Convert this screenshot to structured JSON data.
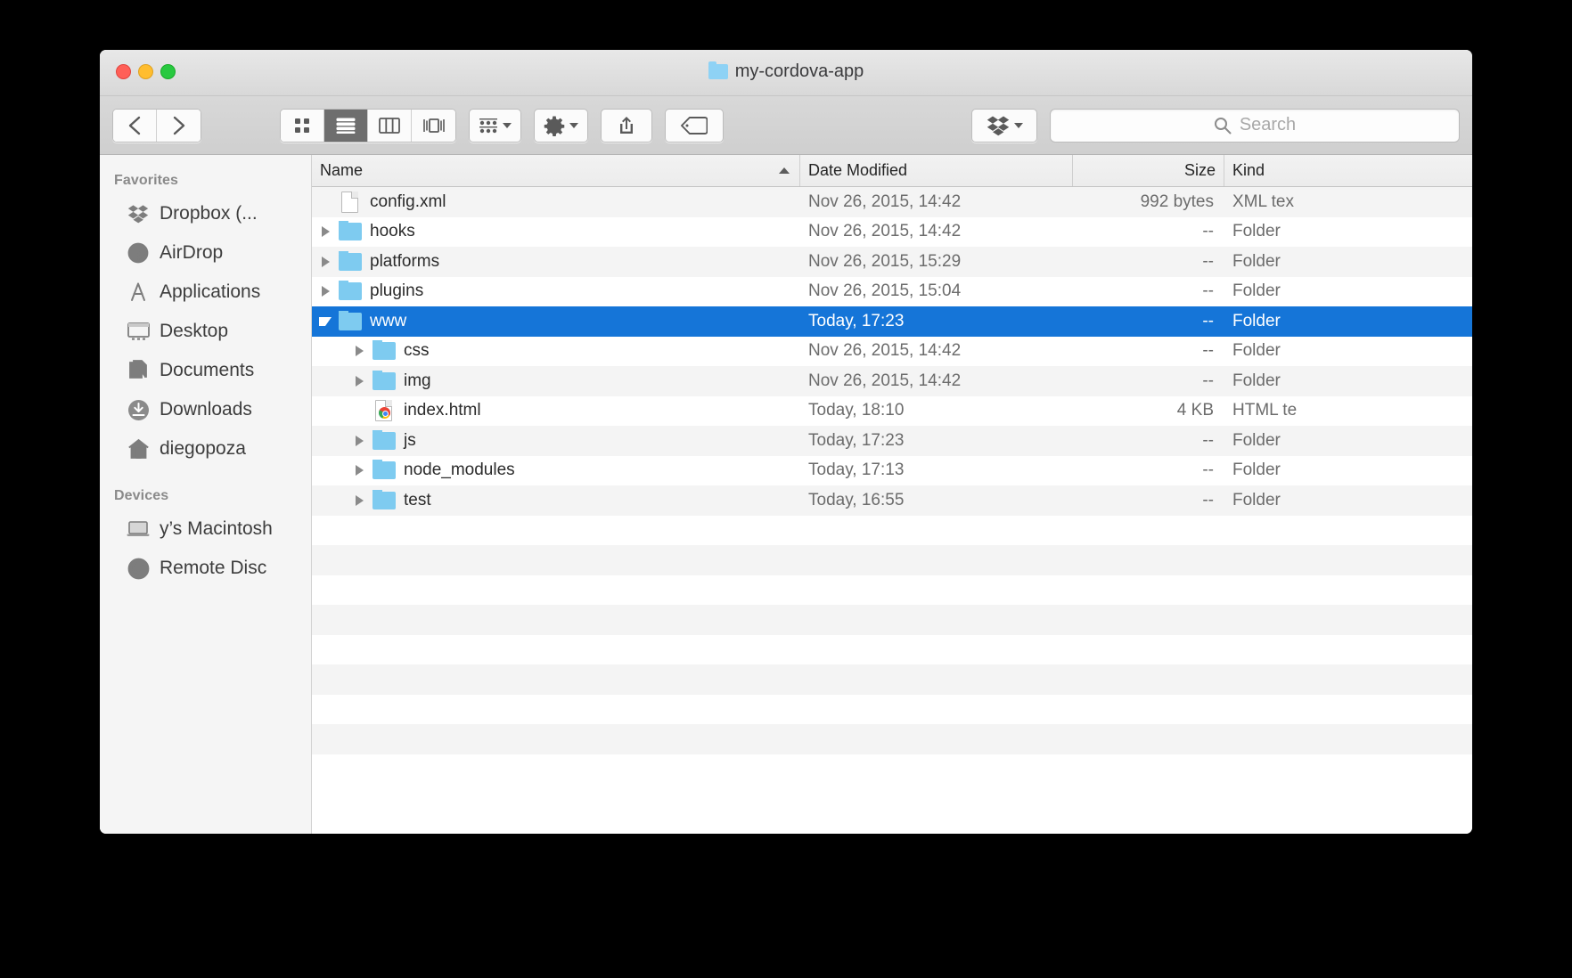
{
  "window": {
    "title": "my-cordova-app",
    "title_icon": "folder-icon",
    "controls": {
      "close": "close-button",
      "minimize": "minimize-button",
      "maximize": "maximize-button"
    }
  },
  "toolbar": {
    "back_label": "‹",
    "forward_label": "›",
    "view_modes": [
      {
        "name": "icon-view",
        "active": false
      },
      {
        "name": "list-view",
        "active": true
      },
      {
        "name": "column-view",
        "active": false
      },
      {
        "name": "coverflow-view",
        "active": false
      }
    ],
    "arrange_label": "arrange-icon",
    "action_label": "gear-icon",
    "share_label": "share-icon",
    "tag_label": "tag-icon",
    "dropbox_label": "dropbox-icon"
  },
  "search": {
    "placeholder": "Search",
    "value": ""
  },
  "sidebar": {
    "sections": [
      {
        "header": "Favorites",
        "items": [
          {
            "label": "Dropbox (...",
            "icon": "dropbox-icon"
          },
          {
            "label": "AirDrop",
            "icon": "airdrop-icon"
          },
          {
            "label": "Applications",
            "icon": "applications-icon"
          },
          {
            "label": "Desktop",
            "icon": "desktop-icon"
          },
          {
            "label": "Documents",
            "icon": "documents-icon"
          },
          {
            "label": "Downloads",
            "icon": "downloads-icon"
          },
          {
            "label": "diegopoza",
            "icon": "home-icon"
          }
        ]
      },
      {
        "header": "Devices",
        "items": [
          {
            "label": "y’s Macintosh",
            "icon": "laptop-icon"
          },
          {
            "label": "Remote Disc",
            "icon": "disc-icon"
          }
        ]
      }
    ]
  },
  "filelist": {
    "columns": {
      "name": "Name",
      "date": "Date Modified",
      "size": "Size",
      "kind": "Kind"
    },
    "sort_column": "Name",
    "sort_direction": "ascending",
    "rows": [
      {
        "name": "config.xml",
        "date": "Nov 26, 2015, 14:42",
        "size": "992 bytes",
        "kind": "XML tex",
        "icon": "document-icon",
        "indent": 0,
        "disclosure": "none",
        "selected": false
      },
      {
        "name": "hooks",
        "date": "Nov 26, 2015, 14:42",
        "size": "--",
        "kind": "Folder",
        "icon": "folder-icon",
        "indent": 0,
        "disclosure": "closed",
        "selected": false
      },
      {
        "name": "platforms",
        "date": "Nov 26, 2015, 15:29",
        "size": "--",
        "kind": "Folder",
        "icon": "folder-icon",
        "indent": 0,
        "disclosure": "closed",
        "selected": false
      },
      {
        "name": "plugins",
        "date": "Nov 26, 2015, 15:04",
        "size": "--",
        "kind": "Folder",
        "icon": "folder-icon",
        "indent": 0,
        "disclosure": "closed",
        "selected": false
      },
      {
        "name": "www",
        "date": "Today, 17:23",
        "size": "--",
        "kind": "Folder",
        "icon": "folder-icon",
        "indent": 0,
        "disclosure": "open",
        "selected": true
      },
      {
        "name": "css",
        "date": "Nov 26, 2015, 14:42",
        "size": "--",
        "kind": "Folder",
        "icon": "folder-icon",
        "indent": 1,
        "disclosure": "closed",
        "selected": false
      },
      {
        "name": "img",
        "date": "Nov 26, 2015, 14:42",
        "size": "--",
        "kind": "Folder",
        "icon": "folder-icon",
        "indent": 1,
        "disclosure": "closed",
        "selected": false
      },
      {
        "name": "index.html",
        "date": "Today, 18:10",
        "size": "4 KB",
        "kind": "HTML te",
        "icon": "chrome-doc-icon",
        "indent": 1,
        "disclosure": "none",
        "selected": false
      },
      {
        "name": "js",
        "date": "Today, 17:23",
        "size": "--",
        "kind": "Folder",
        "icon": "folder-icon",
        "indent": 1,
        "disclosure": "closed",
        "selected": false
      },
      {
        "name": "node_modules",
        "date": "Today, 17:13",
        "size": "--",
        "kind": "Folder",
        "icon": "folder-icon",
        "indent": 1,
        "disclosure": "closed",
        "selected": false
      },
      {
        "name": "test",
        "date": "Today, 16:55",
        "size": "--",
        "kind": "Folder",
        "icon": "folder-icon",
        "indent": 1,
        "disclosure": "closed",
        "selected": false
      }
    ]
  },
  "colors": {
    "selection": "#1575d8",
    "folder": "#7ecbf0",
    "window_chrome": "#d8d8d8",
    "sidebar": "#f5f5f5"
  }
}
